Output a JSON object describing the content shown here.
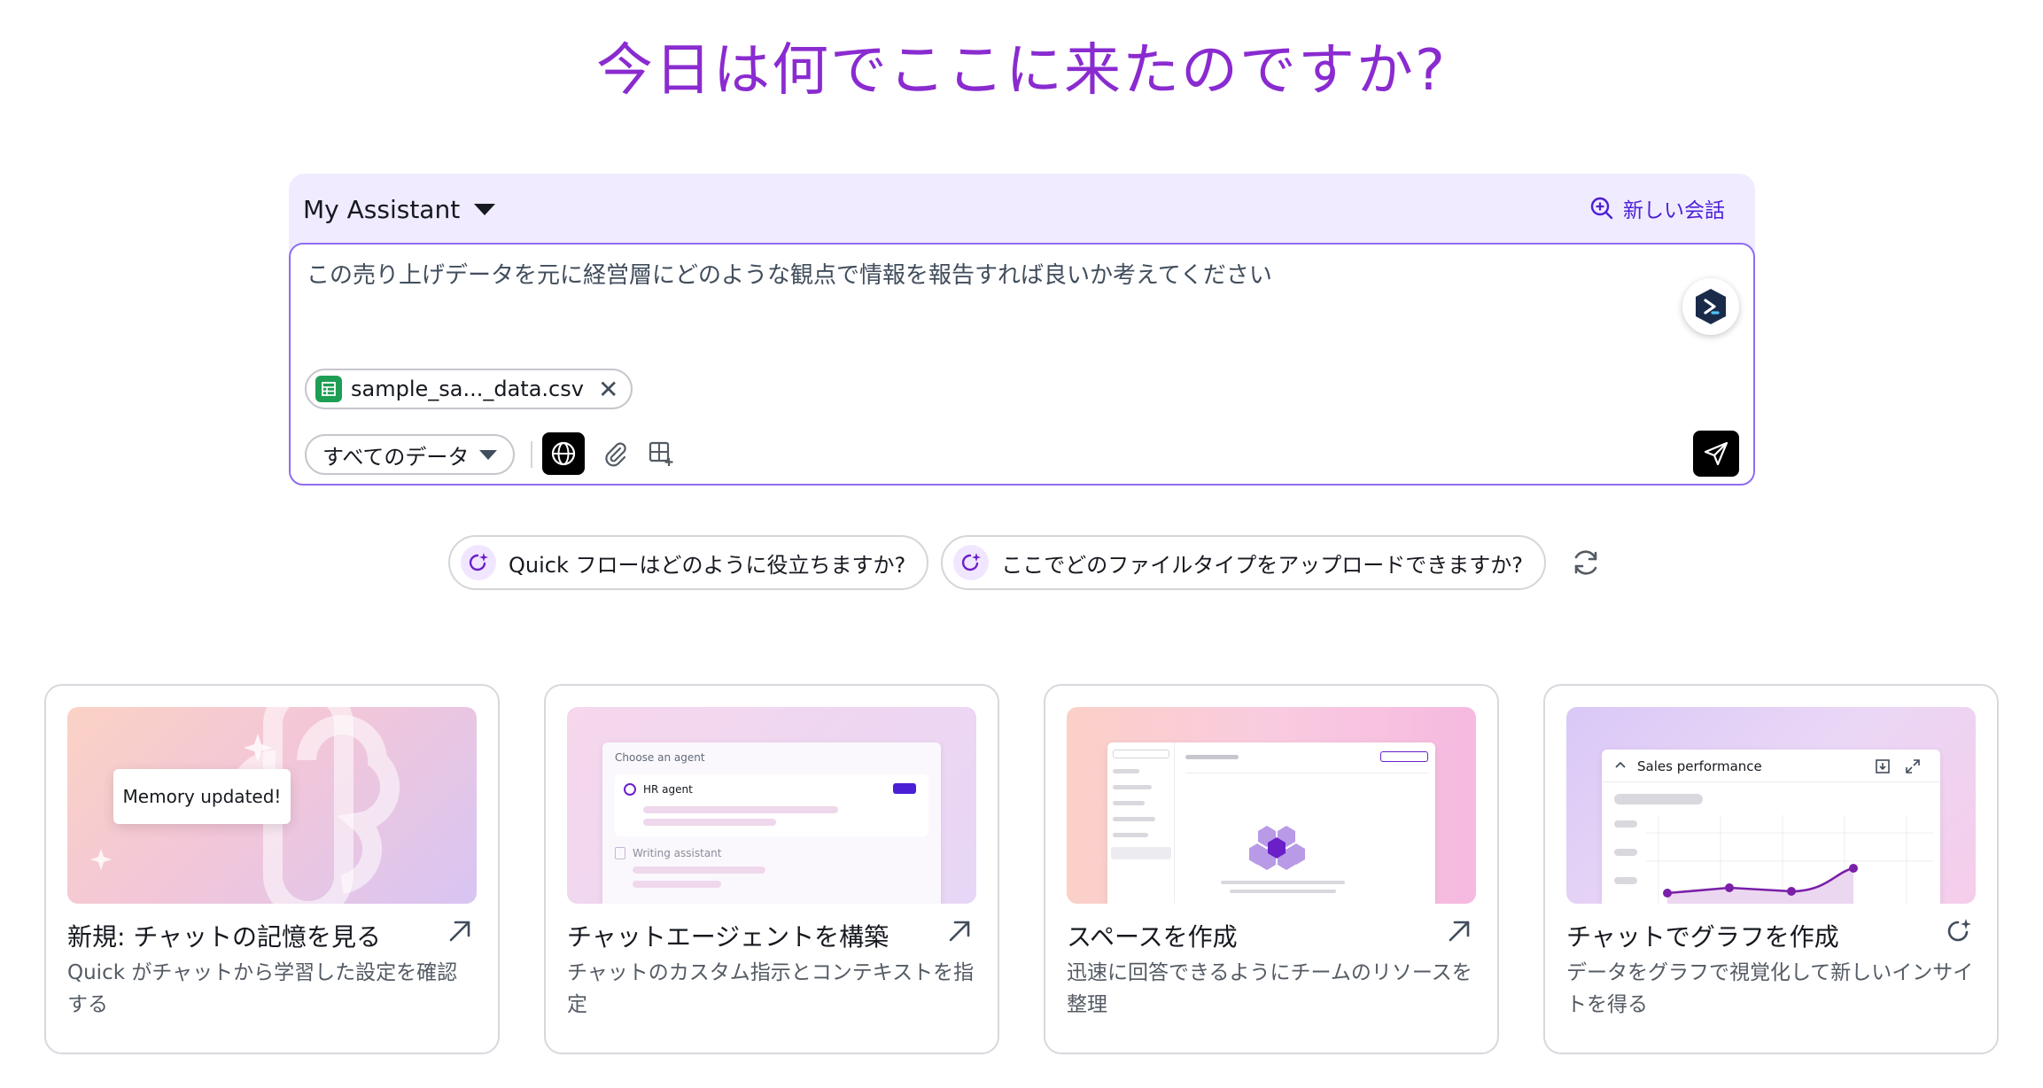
{
  "hero": {
    "title": "今日は何でここに来たのですか?"
  },
  "composer": {
    "assistant_label": "My Assistant",
    "new_chat_label": "新しい会話",
    "prompt_text": "この売り上げデータを元に経営層にどのような観点で情報を報告すれば良いか考えてください",
    "attachment": {
      "file_name": "sample_sa..._data.csv",
      "icon": "spreadsheet-icon"
    },
    "scope_select": {
      "selected": "すべてのデータ"
    },
    "tools": [
      "globe-icon",
      "paperclip-icon",
      "add-grid-icon"
    ],
    "send_icon": "send-icon"
  },
  "suggestions": [
    {
      "label": "Quick フローはどのように役立ちますか?"
    },
    {
      "label": "ここでどのファイルタイプをアップロードできますか?"
    }
  ],
  "cards": [
    {
      "title": "新規: チャットの記憶を見る",
      "desc": "Quick がチャットから学習した設定を確認する",
      "image_caption": "Memory updated!",
      "corner_icon": "arrow-up-right-icon"
    },
    {
      "title": "チャットエージェントを構築",
      "desc": "チャットのカスタム指示とコンテキストを指定",
      "image": {
        "header": "Choose an agent",
        "item1": "HR agent",
        "item2": "Writing assistant"
      },
      "corner_icon": "arrow-up-right-icon"
    },
    {
      "title": "スペースを作成",
      "desc": "迅速に回答できるようにチームのリソースを整理",
      "corner_icon": "arrow-up-right-icon"
    },
    {
      "title": "チャットでグラフを作成",
      "desc": "データをグラフで視覚化して新しいインサイトを得る",
      "image": {
        "header": "Sales performance"
      },
      "corner_icon": "spark-refresh-icon"
    }
  ],
  "colors": {
    "accent": "#4b1fd6",
    "title": "#8a2bd0",
    "composer_bg": "#f0ebff",
    "border_focus": "#8f6cf0"
  }
}
